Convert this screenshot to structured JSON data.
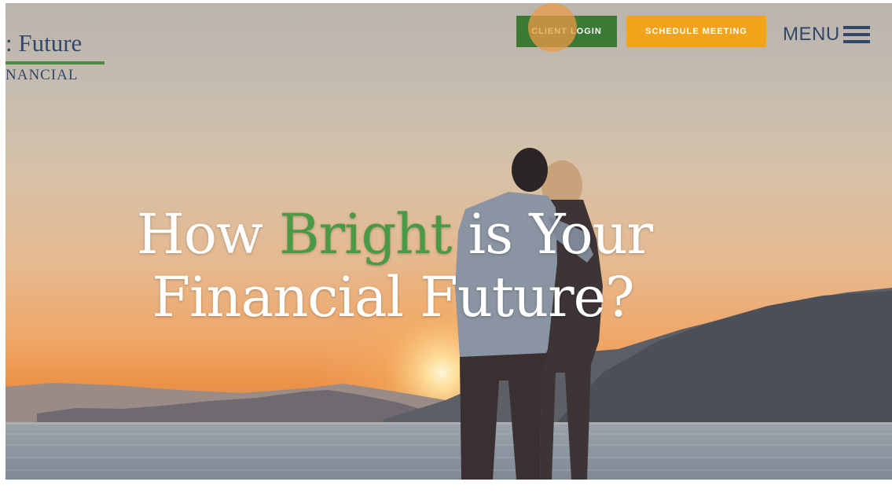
{
  "logo": {
    "line1": ": Future",
    "line2": "NANCIAL"
  },
  "header": {
    "client_login_label": "CLIENT LOGIN",
    "schedule_meeting_label": "SCHEDULE MEETING",
    "menu_label": "MENU"
  },
  "hero": {
    "headline_part1": "How ",
    "headline_accent": "Bright",
    "headline_part2": " is Your",
    "headline_line2": "Financial Future?"
  },
  "colors": {
    "brand_navy": "#33476b",
    "brand_green": "#3b7a35",
    "accent_orange": "#f3a31a",
    "headline_accent": "#4a9a45"
  },
  "icons": {
    "menu": "hamburger-icon"
  }
}
